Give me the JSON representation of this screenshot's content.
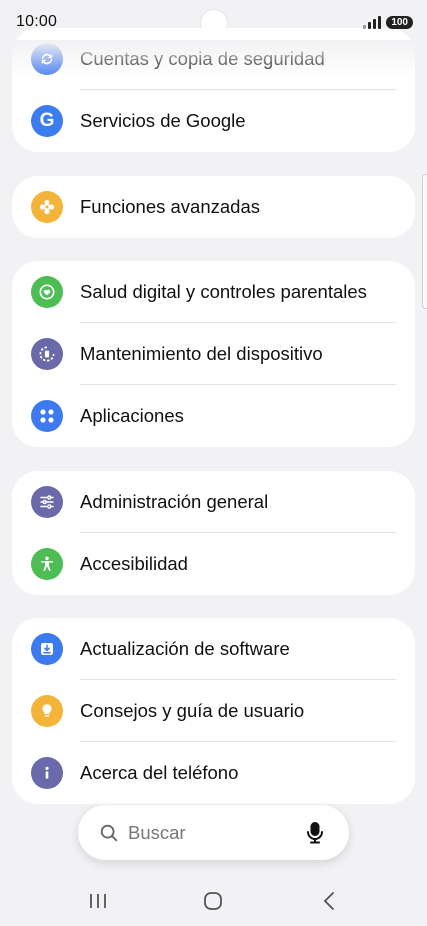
{
  "status": {
    "time": "10:00",
    "battery": "100"
  },
  "groups": [
    {
      "items": [
        {
          "label": "Cuentas y copia de seguridad",
          "icon": "sync-icon",
          "color": "#4a7ff0"
        },
        {
          "label": "Servicios de Google",
          "icon": "google-icon",
          "color": "#3b7cf0"
        }
      ]
    },
    {
      "items": [
        {
          "label": "Funciones avanzadas",
          "icon": "gear-flower-icon",
          "color": "#f4b43a"
        }
      ]
    },
    {
      "items": [
        {
          "label": "Salud digital y controles parentales",
          "icon": "heart-circle-icon",
          "color": "#4fbd55"
        },
        {
          "label": "Mantenimiento del dispositivo",
          "icon": "device-care-icon",
          "color": "#6a69a9"
        },
        {
          "label": "Aplicaciones",
          "icon": "apps-grid-icon",
          "color": "#3d7af0"
        }
      ]
    },
    {
      "items": [
        {
          "label": "Administración general",
          "icon": "sliders-icon",
          "color": "#6a69a9"
        },
        {
          "label": "Accesibilidad",
          "icon": "accessibility-icon",
          "color": "#4fbd55"
        }
      ]
    },
    {
      "items": [
        {
          "label": "Actualización de software",
          "icon": "software-update-icon",
          "color": "#3d7af0"
        },
        {
          "label": "Consejos y guía de usuario",
          "icon": "lightbulb-icon",
          "color": "#f4b43a"
        },
        {
          "label": "Acerca del teléfono",
          "icon": "info-icon",
          "color": "#6a69a9"
        }
      ]
    }
  ],
  "search": {
    "placeholder": "Buscar"
  }
}
